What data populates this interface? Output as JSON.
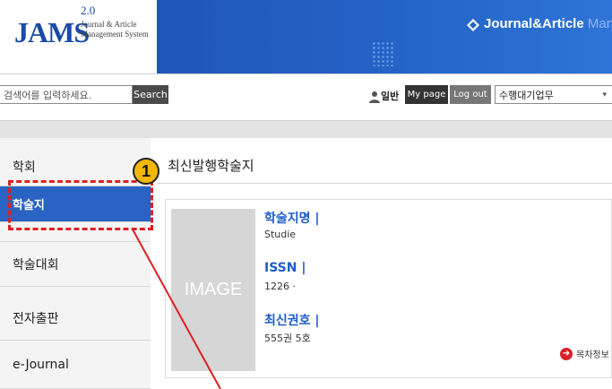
{
  "header": {
    "logo": {
      "name": "JAMS",
      "version": "2.0",
      "subtitle_line1": "Journal & Article",
      "subtitle_line2": "Management System"
    },
    "banner": {
      "title": "Journal&Article",
      "title_suffix": "Manager"
    }
  },
  "topbar": {
    "search": {
      "placeholder": "검색어를 입력하세요.",
      "button_label": "Search"
    },
    "user": {
      "label": "일반"
    },
    "mypage_label": "My page",
    "logout_label": "Log out",
    "role_select": {
      "value": "수행대기업무"
    }
  },
  "sidebar": {
    "items": [
      {
        "label": "학회"
      },
      {
        "label": "학술지"
      },
      {
        "label": "학술대회"
      },
      {
        "label": "전자출판"
      },
      {
        "label": "e-Journal"
      }
    ]
  },
  "annotation": {
    "badge": "1"
  },
  "main": {
    "title": "최신발행학술지",
    "card": {
      "image_placeholder": "IMAGE",
      "fields": [
        {
          "label": "학술지명 |",
          "value": "Studie"
        },
        {
          "label": "ISSN |",
          "value": "1226 ·"
        },
        {
          "label": "최신권호 |",
          "value": "555권  5호"
        }
      ],
      "toc_link": "목차정보"
    }
  },
  "colors": {
    "brand_blue": "#2a63c4",
    "banner_blue": "#2566c8",
    "highlight_red": "#e02020",
    "badge_yellow": "#f2b705"
  }
}
